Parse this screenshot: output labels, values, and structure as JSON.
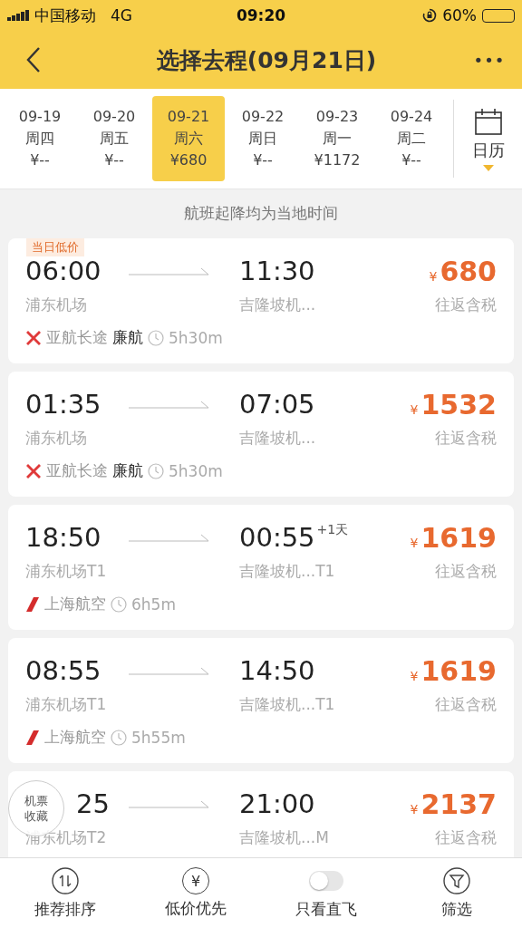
{
  "status_bar": {
    "carrier": "中国移动",
    "network": "4G",
    "time": "09:20",
    "battery_text": "60%"
  },
  "nav": {
    "title": "选择去程(09月21日)",
    "more": "•••"
  },
  "dates": [
    {
      "date": "09-19",
      "weekday": "周四",
      "price": "¥--",
      "selected": false
    },
    {
      "date": "09-20",
      "weekday": "周五",
      "price": "¥--",
      "selected": false
    },
    {
      "date": "09-21",
      "weekday": "周六",
      "price": "¥680",
      "selected": true
    },
    {
      "date": "09-22",
      "weekday": "周日",
      "price": "¥--",
      "selected": false
    },
    {
      "date": "09-23",
      "weekday": "周一",
      "price": "¥1172",
      "selected": false
    },
    {
      "date": "09-24",
      "weekday": "周二",
      "price": "¥--",
      "selected": false
    }
  ],
  "calendar_button": {
    "label": "日历"
  },
  "notice": "航班起降均为当地时间",
  "flights": [
    {
      "badge": "当日低价",
      "departure": "06:00",
      "departure_covered": false,
      "arrival": "11:30",
      "dep_airport": "浦东机场",
      "arr_airport": "吉隆坡机...",
      "currency": "¥",
      "price": "680",
      "price_note": "往返含税",
      "airline": {
        "kind": "cross",
        "name": "亚航长途",
        "tag": "廉航"
      },
      "duration": "5h30m"
    },
    {
      "departure": "01:35",
      "departure_covered": false,
      "arrival": "07:05",
      "dep_airport": "浦东机场",
      "arr_airport": "吉隆坡机...",
      "currency": "¥",
      "price": "1532",
      "price_note": "往返含税",
      "airline": {
        "kind": "cross",
        "name": "亚航长途",
        "tag": "廉航"
      },
      "duration": "5h30m"
    },
    {
      "departure": "18:50",
      "departure_covered": false,
      "arrival": "00:55",
      "arrival_offset": "+1天",
      "dep_airport": "浦东机场T1",
      "arr_airport": "吉隆坡机...T1",
      "currency": "¥",
      "price": "1619",
      "price_note": "往返含税",
      "airline": {
        "kind": "tail",
        "name": "上海航空"
      },
      "duration": "6h5m"
    },
    {
      "departure": "08:55",
      "departure_covered": false,
      "arrival": "14:50",
      "dep_airport": "浦东机场T1",
      "arr_airport": "吉隆坡机...T1",
      "currency": "¥",
      "price": "1619",
      "price_note": "往返含税",
      "airline": {
        "kind": "tail",
        "name": "上海航空"
      },
      "duration": "5h55m"
    },
    {
      "departure": "25",
      "departure_covered": true,
      "arrival": "21:00",
      "dep_airport": "浦东机场T2",
      "arr_airport": "吉隆坡机...M",
      "currency": "¥",
      "price": "2137",
      "price_note": "往返含税"
    }
  ],
  "favorite_bubble": {
    "line1": "机票",
    "line2": "收藏"
  },
  "toolbar": [
    {
      "kind": "sort",
      "label": "推荐排序"
    },
    {
      "kind": "price",
      "label": "低价优先",
      "glyph": "¥"
    },
    {
      "kind": "toggle",
      "label": "只看直飞",
      "on": false
    },
    {
      "kind": "filter",
      "label": "筛选"
    }
  ]
}
